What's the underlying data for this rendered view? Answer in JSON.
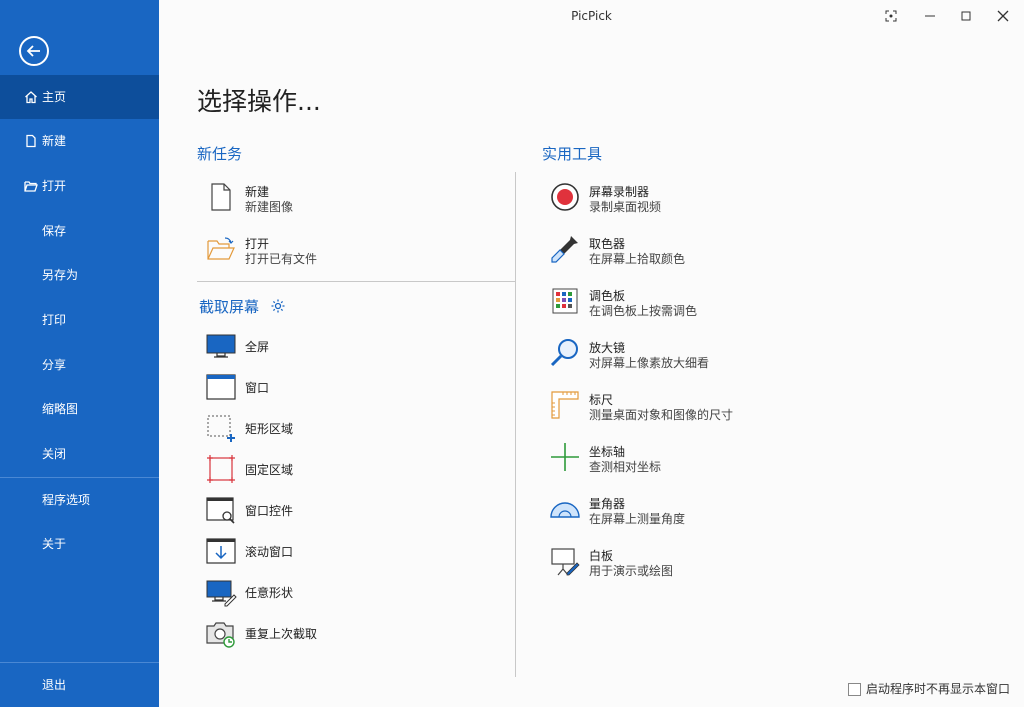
{
  "app": {
    "title": "PicPick"
  },
  "sidebar": {
    "items": [
      {
        "label": "主页",
        "icon": "home-icon"
      },
      {
        "label": "新建",
        "icon": "new-file-icon"
      },
      {
        "label": "打开",
        "icon": "folder-open-icon"
      },
      {
        "label": "保存"
      },
      {
        "label": "另存为"
      },
      {
        "label": "打印"
      },
      {
        "label": "分享"
      },
      {
        "label": "缩略图"
      },
      {
        "label": "关闭"
      },
      {
        "label": "程序选项"
      },
      {
        "label": "关于"
      },
      {
        "label": "退出"
      }
    ]
  },
  "main": {
    "title": "选择操作...",
    "new_task": {
      "heading": "新任务",
      "items": [
        {
          "title": "新建",
          "subtitle": "新建图像"
        },
        {
          "title": "打开",
          "subtitle": "打开已有文件"
        }
      ]
    },
    "capture": {
      "heading": "截取屏幕",
      "items": [
        {
          "title": "全屏"
        },
        {
          "title": "窗口"
        },
        {
          "title": "矩形区域"
        },
        {
          "title": "固定区域"
        },
        {
          "title": "窗口控件"
        },
        {
          "title": "滚动窗口"
        },
        {
          "title": "任意形状"
        },
        {
          "title": "重复上次截取"
        }
      ]
    },
    "tools": {
      "heading": "实用工具",
      "items": [
        {
          "title": "屏幕录制器",
          "subtitle": "录制桌面视频"
        },
        {
          "title": "取色器",
          "subtitle": "在屏幕上拾取颜色"
        },
        {
          "title": "调色板",
          "subtitle": "在调色板上按需调色"
        },
        {
          "title": "放大镜",
          "subtitle": "对屏幕上像素放大细看"
        },
        {
          "title": "标尺",
          "subtitle": "测量桌面对象和图像的尺寸"
        },
        {
          "title": "坐标轴",
          "subtitle": "查测相对坐标"
        },
        {
          "title": "量角器",
          "subtitle": "在屏幕上测量角度"
        },
        {
          "title": "白板",
          "subtitle": "用于演示或绘图"
        }
      ]
    }
  },
  "footer": {
    "dont_show_label": "启动程序时不再显示本窗口"
  },
  "colors": {
    "accent": "#1966c2",
    "sidebar_active": "#0d4e9b",
    "record_red": "#e0323c"
  }
}
